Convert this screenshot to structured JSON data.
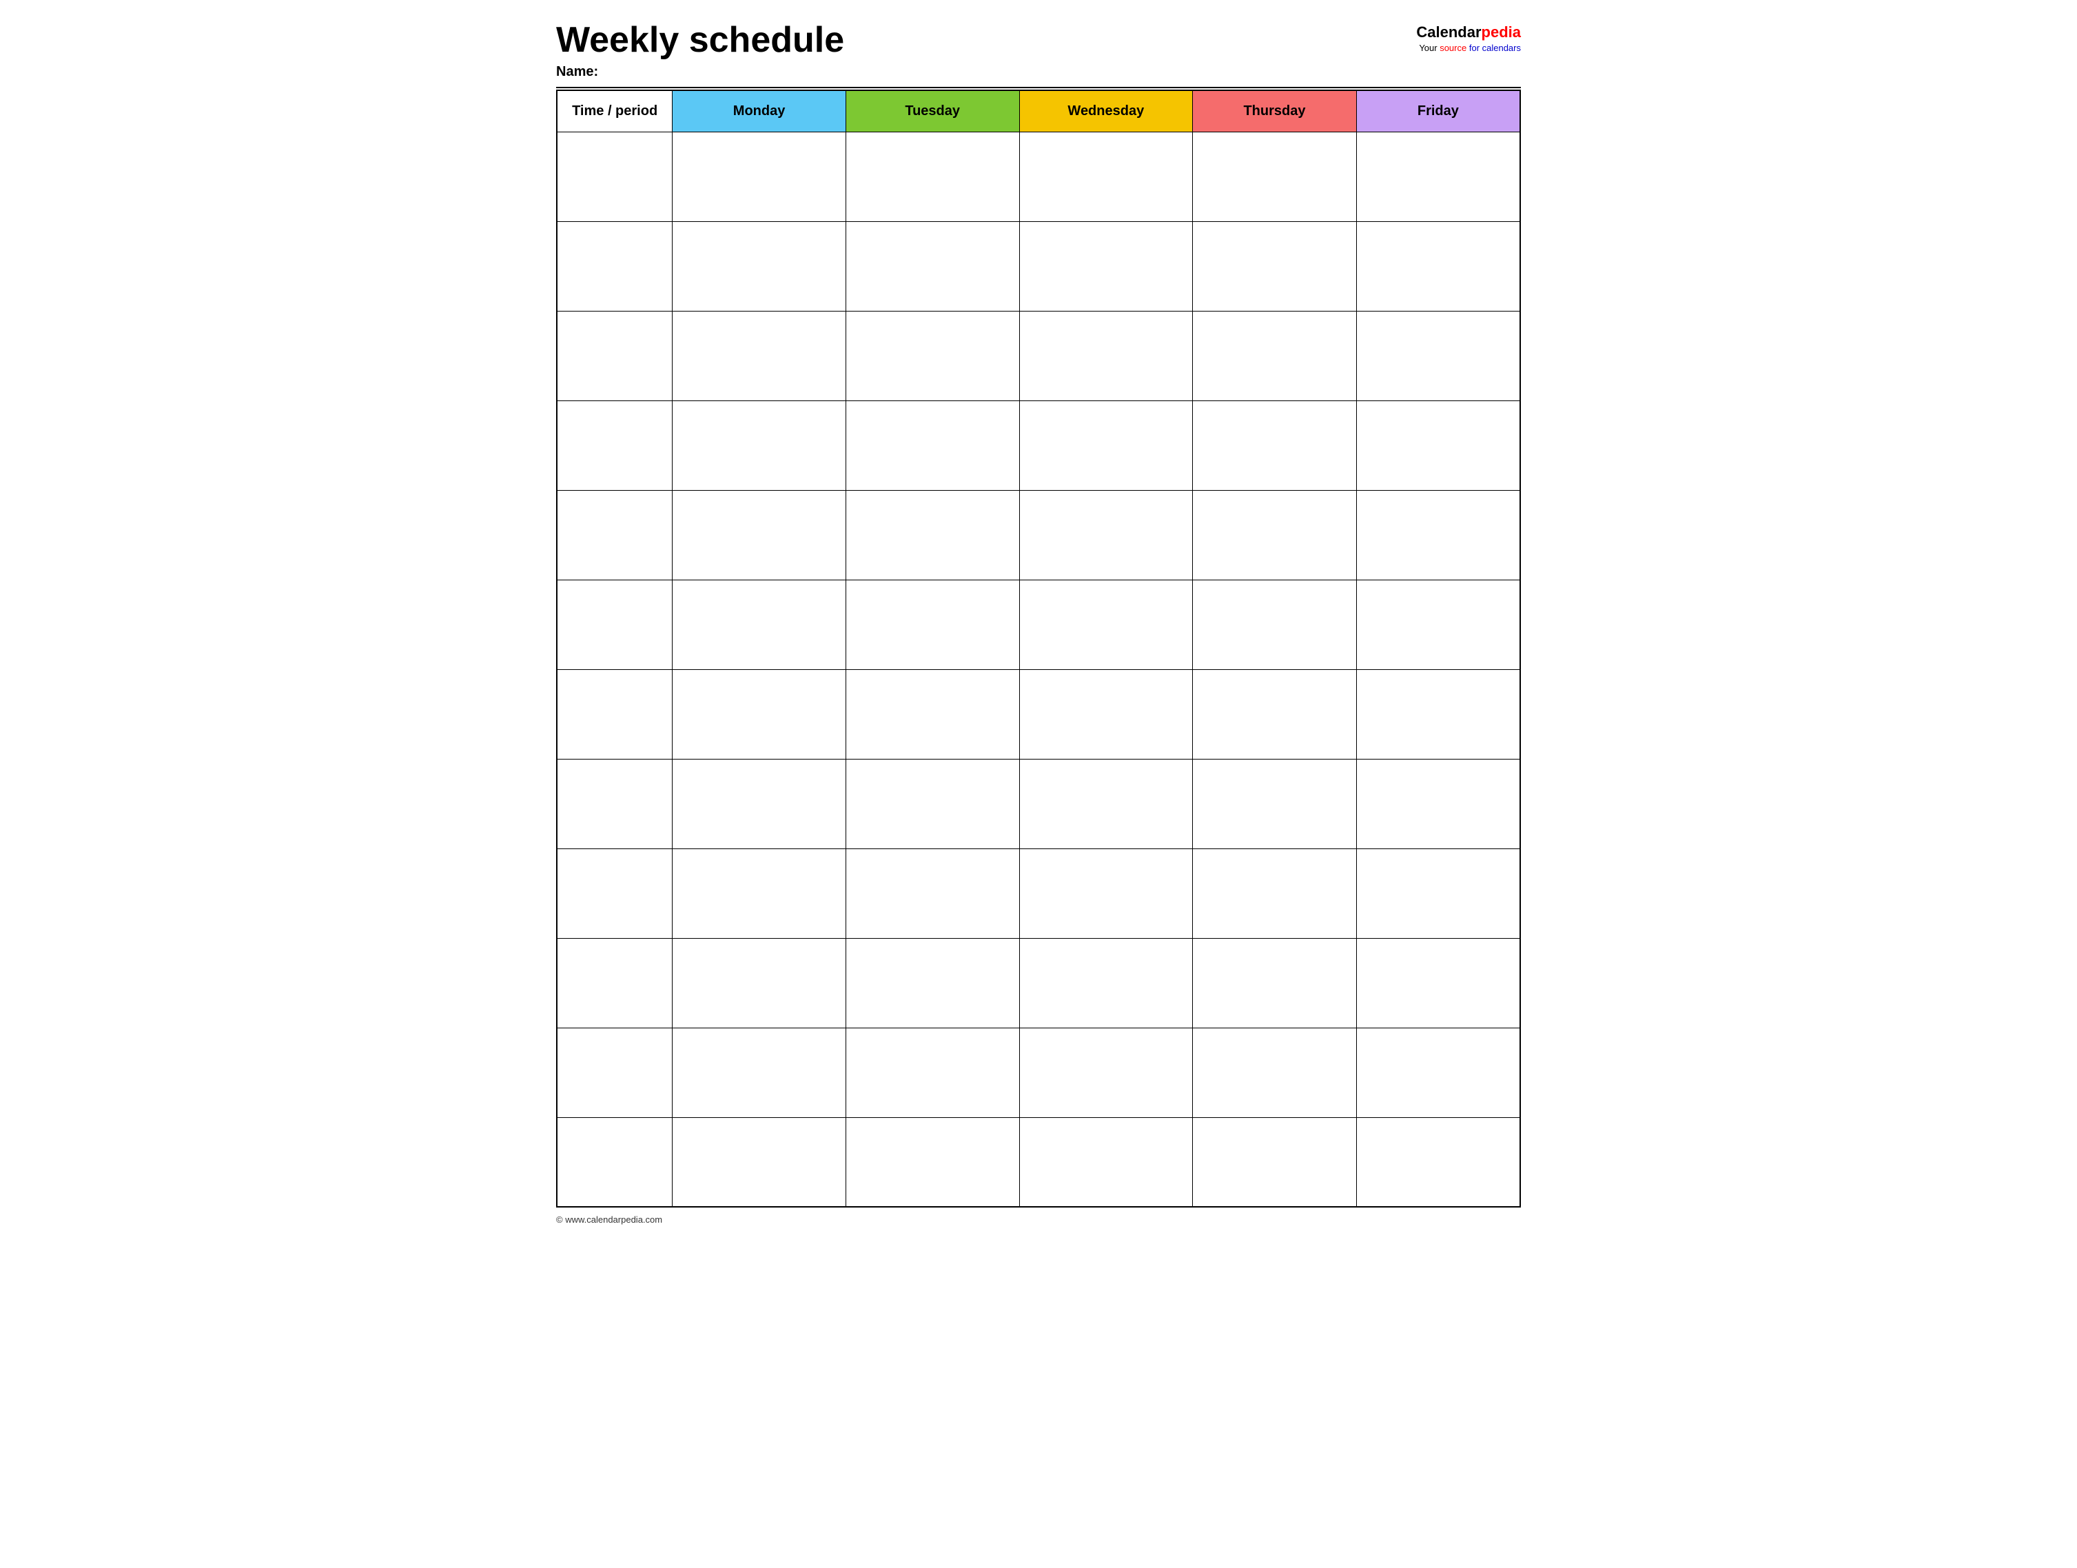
{
  "header": {
    "main_title": "Weekly schedule",
    "name_label": "Name:",
    "logo": {
      "calendar_text": "Calendar",
      "pedia_text": "pedia",
      "subtitle_your": "Your ",
      "subtitle_source": "source",
      "subtitle_rest": " for calendars"
    }
  },
  "table": {
    "headers": {
      "time_period": "Time / period",
      "monday": "Monday",
      "tuesday": "Tuesday",
      "wednesday": "Wednesday",
      "thursday": "Thursday",
      "friday": "Friday"
    },
    "rows": 12
  },
  "footer": {
    "url": "© www.calendarpedia.com"
  }
}
